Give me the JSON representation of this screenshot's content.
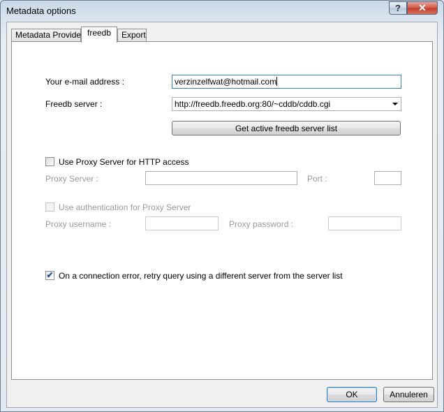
{
  "window": {
    "title": "Metadata options",
    "help_glyph": "?",
    "close_glyph": "✕"
  },
  "tabs": [
    {
      "label": "Metadata Provider",
      "active": false
    },
    {
      "label": "freedb",
      "active": true
    },
    {
      "label": "Export",
      "active": false
    }
  ],
  "freedb": {
    "email_label": "Your e-mail address :",
    "email_value": "verzinzelfwat@hotmail.com",
    "server_label": "Freedb server :",
    "server_value": "http://freedb.freedb.org:80/~cddb/cddb.cgi",
    "get_list_button": "Get active freedb server list",
    "use_proxy_label": "Use Proxy Server for HTTP access",
    "use_proxy_checked": false,
    "proxy_server_label": "Proxy Server :",
    "proxy_server_value": "",
    "port_label": "Port :",
    "port_value": "",
    "use_auth_label": "Use authentication for Proxy Server",
    "use_auth_checked": false,
    "proxy_username_label": "Proxy username :",
    "proxy_username_value": "",
    "proxy_password_label": "Proxy password :",
    "proxy_password_value": "",
    "retry_label": "On a connection error, retry query using a different server from the server list",
    "retry_checked": true
  },
  "footer": {
    "ok_label": "OK",
    "cancel_label": "Annuleren"
  },
  "icons": {
    "checkmark": "✔"
  },
  "colors": {
    "focus_border": "#3c7fb1",
    "close_button": "#c43a2a"
  }
}
